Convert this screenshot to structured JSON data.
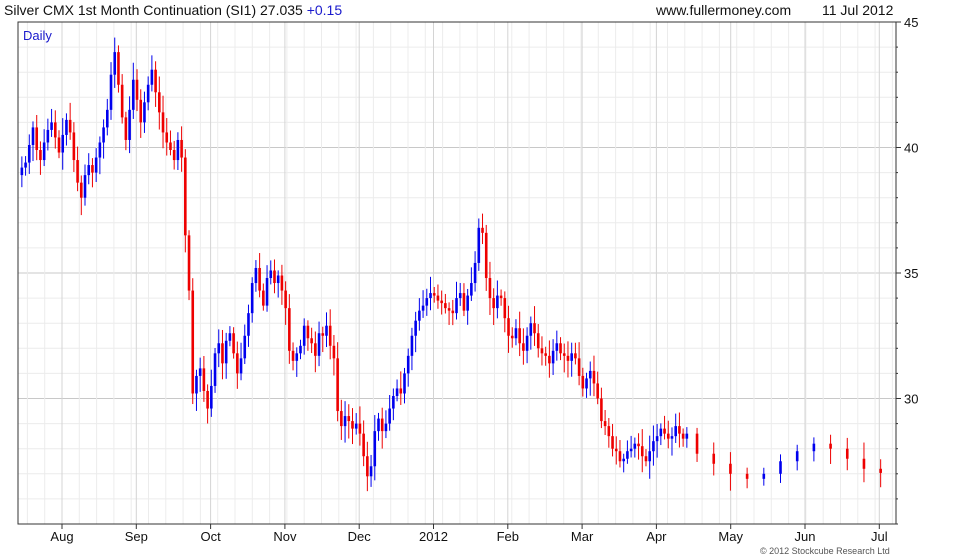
{
  "header": {
    "title_prefix": "Silver CMX 1st Month Continuation (SI1) 27.035",
    "change": "+0.15",
    "website": "www.fullermoney.com",
    "date": "11 Jul 2012"
  },
  "footer": {
    "credit": "© 2012 Stockcube Research Ltd"
  },
  "chart_data": {
    "type": "candlestick",
    "frequency_label": "Daily",
    "ylim": [
      25,
      45
    ],
    "y_ticks": [
      30,
      35,
      40,
      45
    ],
    "y_axis_side": "right",
    "grid": true,
    "x_ticks": [
      "Aug",
      "Sep",
      "Oct",
      "Nov",
      "Dec",
      "2012",
      "Feb",
      "Mar",
      "Apr",
      "May",
      "Jun",
      "Jul"
    ],
    "colors": {
      "up": "#0000ee",
      "down": "#ee0000",
      "grid": "#d8d8d8",
      "axis": "#333333"
    },
    "closes": [
      [
        39.2,
        39.4,
        40.1,
        40.8,
        39.9,
        39.5,
        40.2,
        40.7,
        41.0,
        40.4,
        39.8,
        40.5,
        41.1,
        40.6,
        39.5,
        38.6,
        38.0,
        38.9,
        39.3,
        39.0
      ],
      [
        39.6,
        40.2,
        40.8,
        41.5,
        42.9,
        43.8,
        42.5,
        41.2,
        40.3,
        41.5,
        42.7,
        41.9,
        41.0,
        41.8,
        42.5,
        43.1,
        42.2,
        41.4,
        40.6,
        40.2
      ],
      [
        39.9,
        39.5,
        40.3,
        39.6,
        36.5,
        34.3,
        30.2,
        30.9,
        31.2,
        30.3,
        29.6,
        30.5,
        31.8,
        32.2,
        31.4,
        32.3,
        32.6,
        31.8,
        31.0,
        31.6
      ],
      [
        32.5,
        33.4,
        34.6,
        35.2,
        34.3,
        33.7,
        34.8,
        35.1,
        34.6,
        34.9,
        34.3,
        33.6,
        31.9,
        31.5,
        31.8,
        32.1,
        32.9,
        32.4,
        32.2,
        31.7
      ],
      [
        32.6,
        32.5,
        32.9,
        32.1,
        31.6,
        29.5,
        28.9,
        29.3,
        29.1,
        28.8,
        29.0,
        28.6,
        27.7,
        26.9,
        27.3,
        28.7,
        29.2,
        28.7,
        29.0,
        29.6
      ],
      [
        30.1,
        30.4,
        30.2,
        31.0,
        31.7,
        32.5,
        33.1,
        33.5,
        33.7,
        34.0,
        34.2,
        34.1,
        33.9,
        33.8,
        33.6,
        33.5,
        33.4,
        34.0,
        34.2,
        33.5
      ],
      [
        34.1,
        34.6,
        35.4,
        36.8,
        36.6,
        34.8,
        34.0,
        33.6,
        34.1,
        34.0,
        33.2,
        32.5,
        32.4,
        32.8,
        32.2,
        31.9,
        32.5,
        33.0,
        32.6,
        32.0
      ],
      [
        31.8,
        31.7,
        31.4,
        31.9,
        32.2,
        31.8,
        31.7,
        31.5,
        31.8,
        31.6,
        30.9,
        30.4,
        30.8,
        31.1,
        30.6,
        30.0,
        29.1,
        28.9,
        28.5,
        28.0
      ],
      [
        27.9,
        27.5,
        27.6,
        27.9,
        28.0,
        28.2,
        28.1,
        27.7,
        27.5,
        27.9,
        28.3,
        28.5,
        28.8,
        28.6,
        28.4,
        28.5,
        28.9,
        28.6,
        28.4,
        28.6
      ],
      [
        27.8,
        27.4,
        27.0,
        26.8,
        27.0,
        27.5,
        27.9,
        28.2,
        28.0,
        27.6,
        27.2,
        27.035
      ]
    ]
  }
}
